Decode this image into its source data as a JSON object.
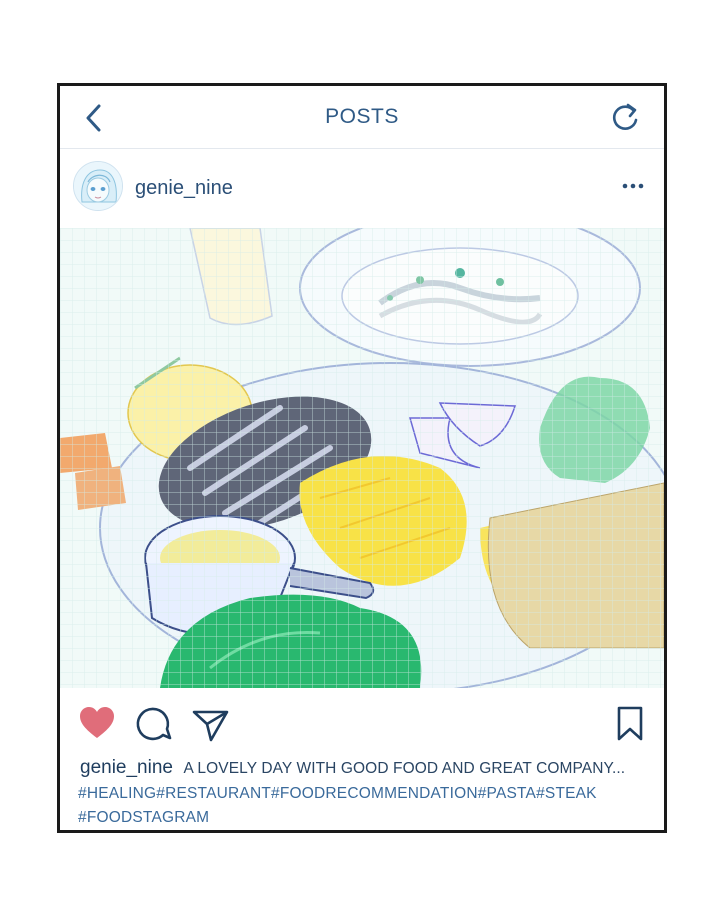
{
  "header": {
    "back_icon": "chevron-left-icon",
    "title": "POSTS",
    "refresh_icon": "refresh-icon"
  },
  "post": {
    "username": "genie_nine",
    "more_icon": "more-horizontal-icon",
    "liked": true,
    "caption_user": "genie_nine",
    "caption_text": "A LOVELY DAY WITH GOOD FOOD AND GREAT COMPANY...",
    "hashtags_line1": "#HEALING#RESTAURANT#FOODRECOMMENDATION#PASTA#STEAK",
    "hashtags_line2": "#FOODSTAGRAM"
  },
  "colors": {
    "accent": "#2f5a86",
    "heart": "#e06d7a",
    "hashtag": "#3a6a9b"
  }
}
